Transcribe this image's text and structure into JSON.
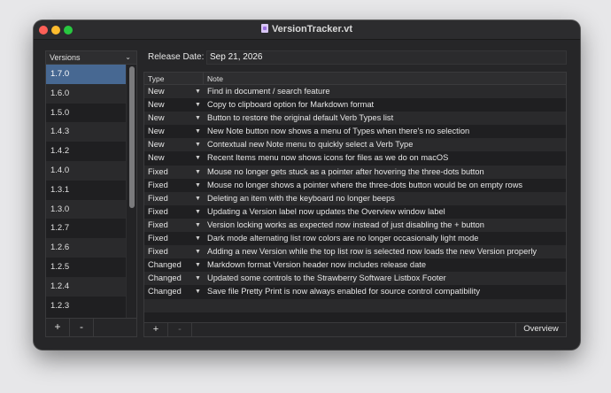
{
  "window": {
    "title": "VersionTracker.vt"
  },
  "versions_panel": {
    "header": "Versions",
    "items": [
      "1.7.0",
      "1.6.0",
      "1.5.0",
      "1.4.3",
      "1.4.2",
      "1.4.0",
      "1.3.1",
      "1.3.0",
      "1.2.7",
      "1.2.6",
      "1.2.5",
      "1.2.4",
      "1.2.3"
    ],
    "selected_index": 0,
    "add_label": "+",
    "remove_label": "-"
  },
  "release": {
    "label": "Release Date:",
    "value": "Sep 21, 2026"
  },
  "notes_table": {
    "columns": {
      "type": "Type",
      "note": "Note"
    },
    "rows": [
      {
        "type": "New",
        "note": "Find in document / search feature"
      },
      {
        "type": "New",
        "note": "Copy to clipboard option for Markdown format"
      },
      {
        "type": "New",
        "note": "Button to restore the original default Verb Types list"
      },
      {
        "type": "New",
        "note": "New Note button now shows a menu of Types when there's no selection"
      },
      {
        "type": "New",
        "note": "Contextual new Note menu to quickly select a Verb Type"
      },
      {
        "type": "New",
        "note": "Recent Items menu now shows icons for files as we do on macOS"
      },
      {
        "type": "Fixed",
        "note": "Mouse no longer gets stuck as a pointer after hovering the three-dots button"
      },
      {
        "type": "Fixed",
        "note": "Mouse no longer shows a pointer where the three-dots button would be on empty rows"
      },
      {
        "type": "Fixed",
        "note": "Deleting an item with the keyboard no longer beeps"
      },
      {
        "type": "Fixed",
        "note": "Updating a Version label now updates the Overview window label"
      },
      {
        "type": "Fixed",
        "note": "Version locking works as expected now instead of just disabling the + button"
      },
      {
        "type": "Fixed",
        "note": "Dark mode alternating list row colors are no longer occasionally light mode"
      },
      {
        "type": "Fixed",
        "note": "Adding a new Version while the top list row is selected now loads the new Version properly"
      },
      {
        "type": "Changed",
        "note": "Markdown format Version header now includes release date"
      },
      {
        "type": "Changed",
        "note": "Updated some controls to the Strawberry Software Listbox Footer"
      },
      {
        "type": "Changed",
        "note": "Save file Pretty Print is now always enabled for source control compatibility"
      },
      {
        "type": "",
        "note": ""
      }
    ],
    "add_label": "+",
    "remove_label": "-",
    "overview_label": "Overview"
  },
  "colors": {
    "selection": "#476892",
    "window_bg": "#262628"
  }
}
